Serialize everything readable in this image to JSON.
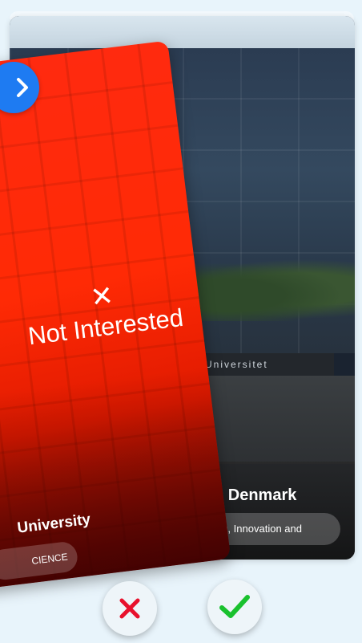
{
  "back_card": {
    "sign_text": "Universitet",
    "title": "n Denmark",
    "tag": "ng, Innovation and"
  },
  "front_card": {
    "overlay_mark": "✕",
    "overlay_text": "Not Interested",
    "title": "University",
    "tag": "CIENCE"
  },
  "colors": {
    "overlay_red": "#ff2a10",
    "nav_blue": "#1e7bf2",
    "reject_red": "#e8112d",
    "accept_green": "#19c12e",
    "background": "#e8f4fb"
  },
  "icons": {
    "nav": "chevron-right-icon",
    "reject": "close-icon",
    "accept": "checkmark-icon"
  }
}
